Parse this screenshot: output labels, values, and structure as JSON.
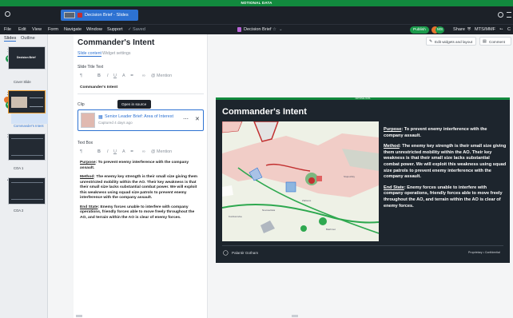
{
  "banner": "NOTIONAL DATA",
  "tab": {
    "label": "Decision Brief - Slides"
  },
  "menu": [
    "File",
    "Edit",
    "View",
    "Form",
    "Navigate",
    "Window",
    "Support"
  ],
  "saved": "Saved",
  "doc_title": "Decision Brief",
  "toolbar": {
    "publish": "Publish",
    "avatar_initials": "MS",
    "share": "Share",
    "classification": "MTS/MMF"
  },
  "panel_tabs": [
    "Slides",
    "Outline"
  ],
  "slides": [
    {
      "num": "1",
      "label": "Cover Slide",
      "title": "Decision Brief",
      "badge": "MS"
    },
    {
      "num": "2",
      "label": "Commander's Intent",
      "badge": "MS"
    },
    {
      "num": "3",
      "label": "COA 1"
    },
    {
      "num": "4",
      "label": "COA 2"
    }
  ],
  "editor": {
    "title": "Commander's Intent",
    "tabs": [
      "Slide content",
      "Widget settings"
    ],
    "slide_title_label": "Slide Title Text",
    "slide_title_value": "Commander's Intent",
    "mention": "Mention",
    "clip_label": "Clip",
    "tooltip": "Open in source",
    "clip_title": "Senior Leader Brief: Area of Interest",
    "clip_sub": "Captured 4 days ago",
    "text_box_label": "Text Box",
    "purpose_head": "Purpose",
    "purpose_body": ": To prevent enemy interference with the company assault.",
    "method_head": "Method",
    "method_body": ": The enemy key strength is their small size giving them unrestricted mobility within the AO. Their key weakness is that their small size lacks substantial combat power. We will exploit this weakness using squad size patrols to prevent enemy interference with the company assault.",
    "endstate_head": "End State",
    "endstate_body": ": Enemy forces unable to interfere with company operations, friendly forces able to move freely throughout the AO, and terrain within the AO is clear of enemy forces."
  },
  "actions": {
    "edit_widgets": "Edit widgets and layout",
    "comment": "Comment"
  },
  "slide": {
    "strip": "NOTIONAL DATA",
    "title": "Commander's Intent",
    "footer_left": "Palantir Gotham",
    "footer_right": "Proprietary • Confidential"
  },
  "map_labels": [
    "Novoselivka",
    "Stupochky",
    "Kurdiumivka",
    "Zaitseve",
    "Bakhmut"
  ],
  "colors": {
    "green": "#128a3e",
    "dark": "#1c2128",
    "accent": "#e89a2c",
    "blue": "#2d72d2"
  }
}
